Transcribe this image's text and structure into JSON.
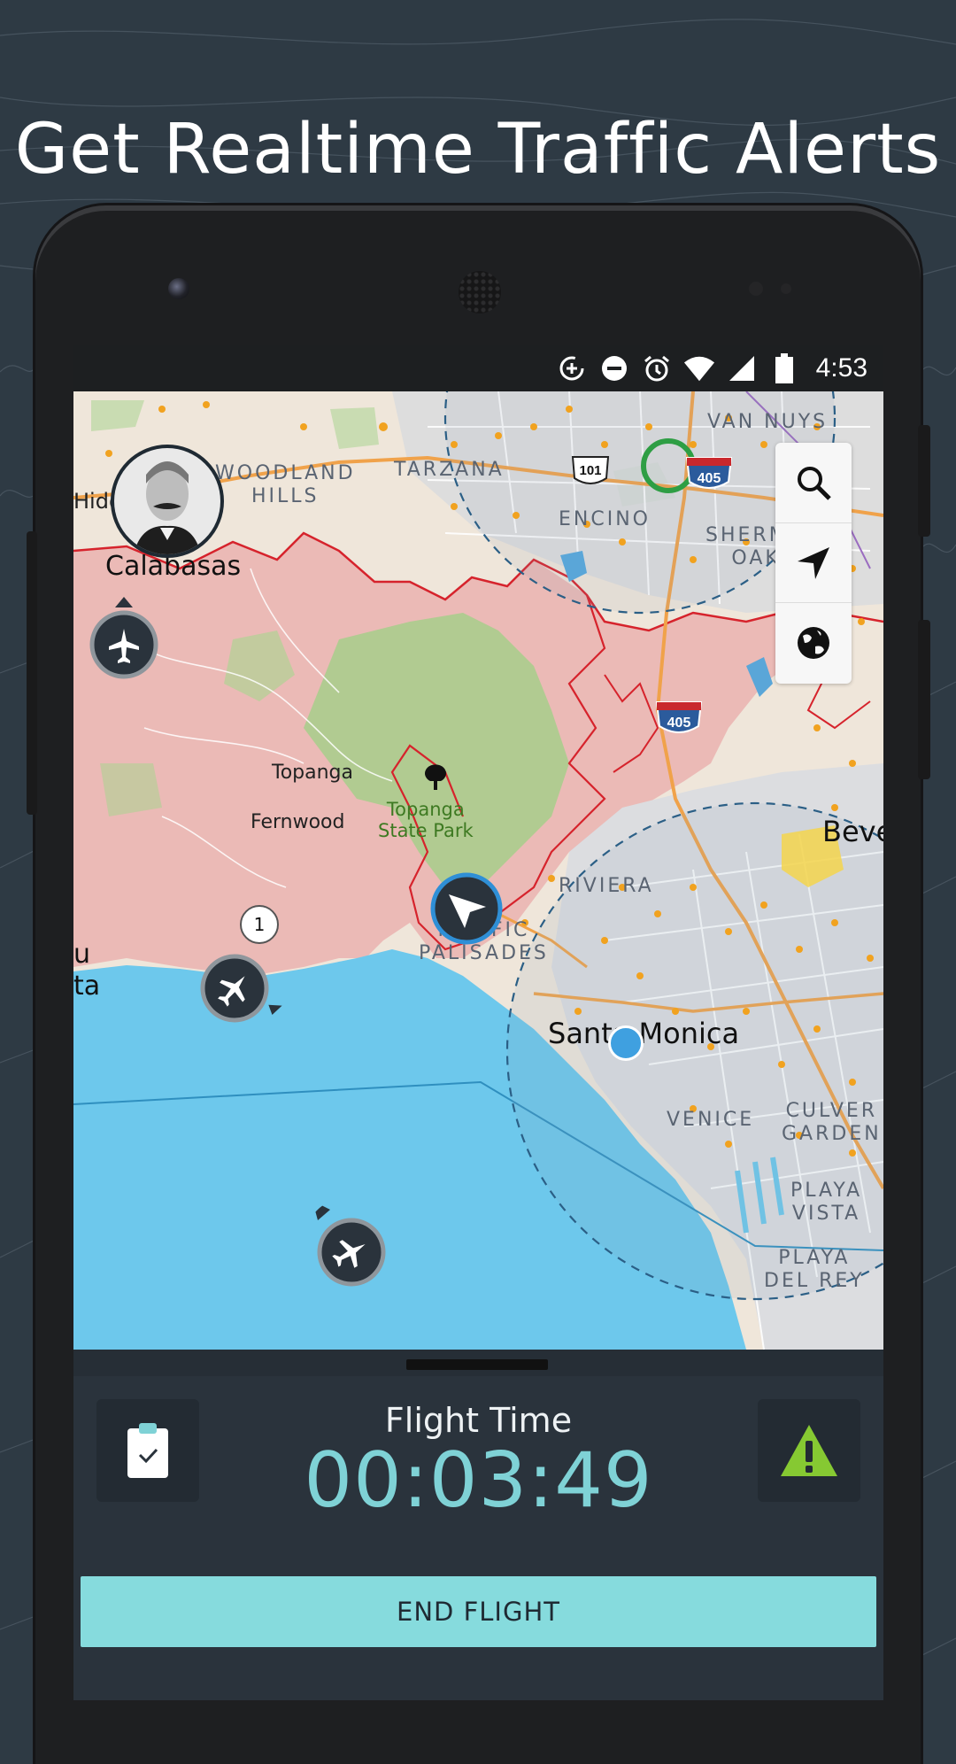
{
  "headline": "Get Realtime Traffic Alerts",
  "status_bar": {
    "time": "4:53",
    "icons": [
      "data-saver-icon",
      "do-not-disturb-icon",
      "alarm-icon",
      "wifi-icon",
      "cellular-icon",
      "battery-icon"
    ]
  },
  "map": {
    "labels": {
      "woodland_hills": "WOODLAND\nHILLS",
      "tarzana": "TARZANA",
      "van_nuys": "VAN NUYS",
      "encino": "ENCINO",
      "sherman_oaks": "SHERMAN\nOAKS",
      "hidden_hills": "Hidd",
      "calabasas": "Calabasas",
      "topanga": "Topanga",
      "fernwood": "Fernwood",
      "topanga_state_park": "Topanga\nState Park",
      "riviera": "RIVIERA",
      "pacific_palisades": "PACIFIC\nPALISADES",
      "santa_monica": "Santa Monica",
      "beverly": "Beve",
      "malibu_partial": "u\nta",
      "venice": "VENICE",
      "culver_gardens": "CULVER\nGARDEN",
      "playa_vista": "PLAYA\nVISTA",
      "playa_del_rey": "PLAYA\nDEL REY"
    },
    "shields": {
      "us101": "101",
      "i405_north": "405",
      "i405_south": "405"
    },
    "cluster_count": "1",
    "controls": [
      "search-icon",
      "navigation-arrow-icon",
      "globe-icon"
    ]
  },
  "panel": {
    "flight_time_label": "Flight Time",
    "flight_time_value": "00:03:49",
    "end_flight_label": "END FLIGHT",
    "left_tile_icon": "clipboard-check-icon",
    "right_tile_icon": "warning-icon"
  },
  "colors": {
    "background": "#2e3a44",
    "accent": "#86dbdd",
    "timer": "#7fd2d6",
    "warning": "#86c932",
    "water": "#6dc8ec",
    "restricted_zone": "#e9b6b4",
    "park": "#a8c98a"
  }
}
